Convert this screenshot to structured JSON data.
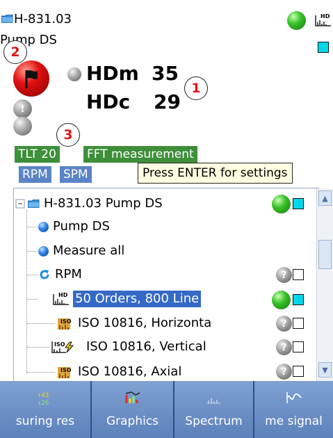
{
  "header": {
    "asset_id": "H-831.03",
    "asset_name": "Pump DS",
    "hdm_label": "HDm",
    "hdm_value": "35",
    "hdc_label": "HDc",
    "hdc_value": "29",
    "status_color": "#39c12b",
    "alarm_color": "#e01010"
  },
  "callouts": [
    "1",
    "2",
    "3"
  ],
  "tags": {
    "tlt": "TLT 20",
    "fft": "FFT measurement",
    "rpm": "RPM",
    "spm": "SPM"
  },
  "tooltip": "Press ENTER for settings",
  "tree": {
    "items": [
      {
        "label": "H-831.03 Pump DS",
        "icon": "folder-icon",
        "status": "ok",
        "indicator": "cyan"
      },
      {
        "label": "Pump DS",
        "icon": "blue-ball-icon"
      },
      {
        "label": "Measure all",
        "icon": "blue-ball-icon"
      },
      {
        "label": "RPM",
        "icon": "refresh-icon",
        "status": "unknown",
        "indicator": "empty"
      },
      {
        "label": "50 Orders, 800 Line",
        "icon": "hd-spectrum-icon",
        "status": "ok",
        "indicator": "cyan",
        "selected": true
      },
      {
        "label": "ISO 10816, Horizonta",
        "icon": "iso-icon",
        "status": "unknown",
        "indicator": "empty"
      },
      {
        "label": "ISO 10816, Vertical",
        "icon": "iso-lightning-icon",
        "status": "unknown",
        "indicator": "empty"
      },
      {
        "label": "ISO 10816, Axial",
        "icon": "iso-icon",
        "status": "unknown",
        "indicator": "empty"
      }
    ],
    "question_mark": "?"
  },
  "toolbar": {
    "buttons": [
      {
        "label": "suring res",
        "icon": "measuring-results-icon"
      },
      {
        "label": "Graphics",
        "icon": "graphics-icon"
      },
      {
        "label": "Spectrum",
        "icon": "spectrum-icon"
      },
      {
        "label": "me signal",
        "icon": "time-signal-icon"
      }
    ]
  }
}
